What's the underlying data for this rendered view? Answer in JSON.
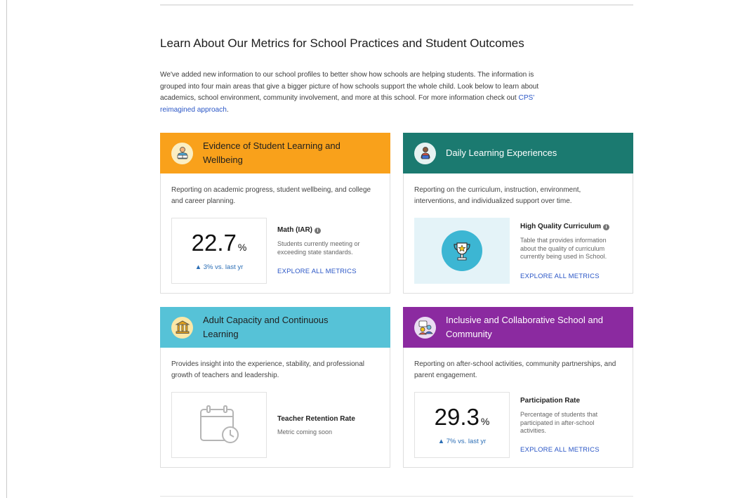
{
  "page": {
    "heading": "Learn About Our Metrics for School Practices and Student Outcomes",
    "intro_text": "We've added new information to our school profiles to better show how schools are helping students. The information is grouped into four main areas that give a bigger picture of how schools support the whole child. Look below to learn about academics, school environment, community involvement, and more at this school.  For more information check out ",
    "intro_link": "CPS' reimagined approach",
    "intro_end": "."
  },
  "cards": [
    {
      "title": "Evidence of Student Learning and Wellbeing",
      "header_color": "#f9a11b",
      "title_color": "#1f1f1f",
      "icon": "student-reading-icon",
      "description": "Reporting on academic progress, student wellbeing, and college and career planning.",
      "metric": {
        "value": "22.7",
        "unit": "%",
        "delta": "▲ 3% vs. last yr",
        "title": "Math (IAR)",
        "info_icon": "info-icon",
        "description": "Students currently meeting or exceeding state standards.",
        "link": "EXPLORE ALL METRICS"
      }
    },
    {
      "title": "Daily Learning Experiences",
      "header_color": "#1b7a70",
      "title_color": "#ffffff",
      "icon": "teacher-icon",
      "description": "Reporting on the curriculum, instruction, environment, interventions, and individualized support over time.",
      "metric": {
        "image": "trophy-icon",
        "title": "High Quality Curriculum",
        "info_icon": "info-icon",
        "description": "Table that provides information about the quality of curriculum currently being used in School.",
        "link": "EXPLORE ALL METRICS"
      }
    },
    {
      "title": "Adult Capacity and Continuous Learning",
      "header_color": "#56c2d7",
      "title_color": "#1f1f1f",
      "icon": "institution-icon",
      "description": "Provides insight into the experience, stability, and professional growth of teachers and leadership.",
      "metric": {
        "image": "calendar-clock-icon",
        "title": "Teacher Retention Rate",
        "description": "Metric coming soon"
      }
    },
    {
      "title": "Inclusive and Collaborative School and Community",
      "header_color": "#8b2aa0",
      "title_color": "#ffffff",
      "icon": "community-icon",
      "description": "Reporting on after-school activities, community partnerships, and parent engagement.",
      "metric": {
        "value": "29.3",
        "unit": "%",
        "delta": "▲ 7% vs. last yr",
        "title": "Participation Rate",
        "description": "Percentage of students that participated in after-school activities.",
        "link": "EXPLORE ALL METRICS"
      }
    }
  ]
}
